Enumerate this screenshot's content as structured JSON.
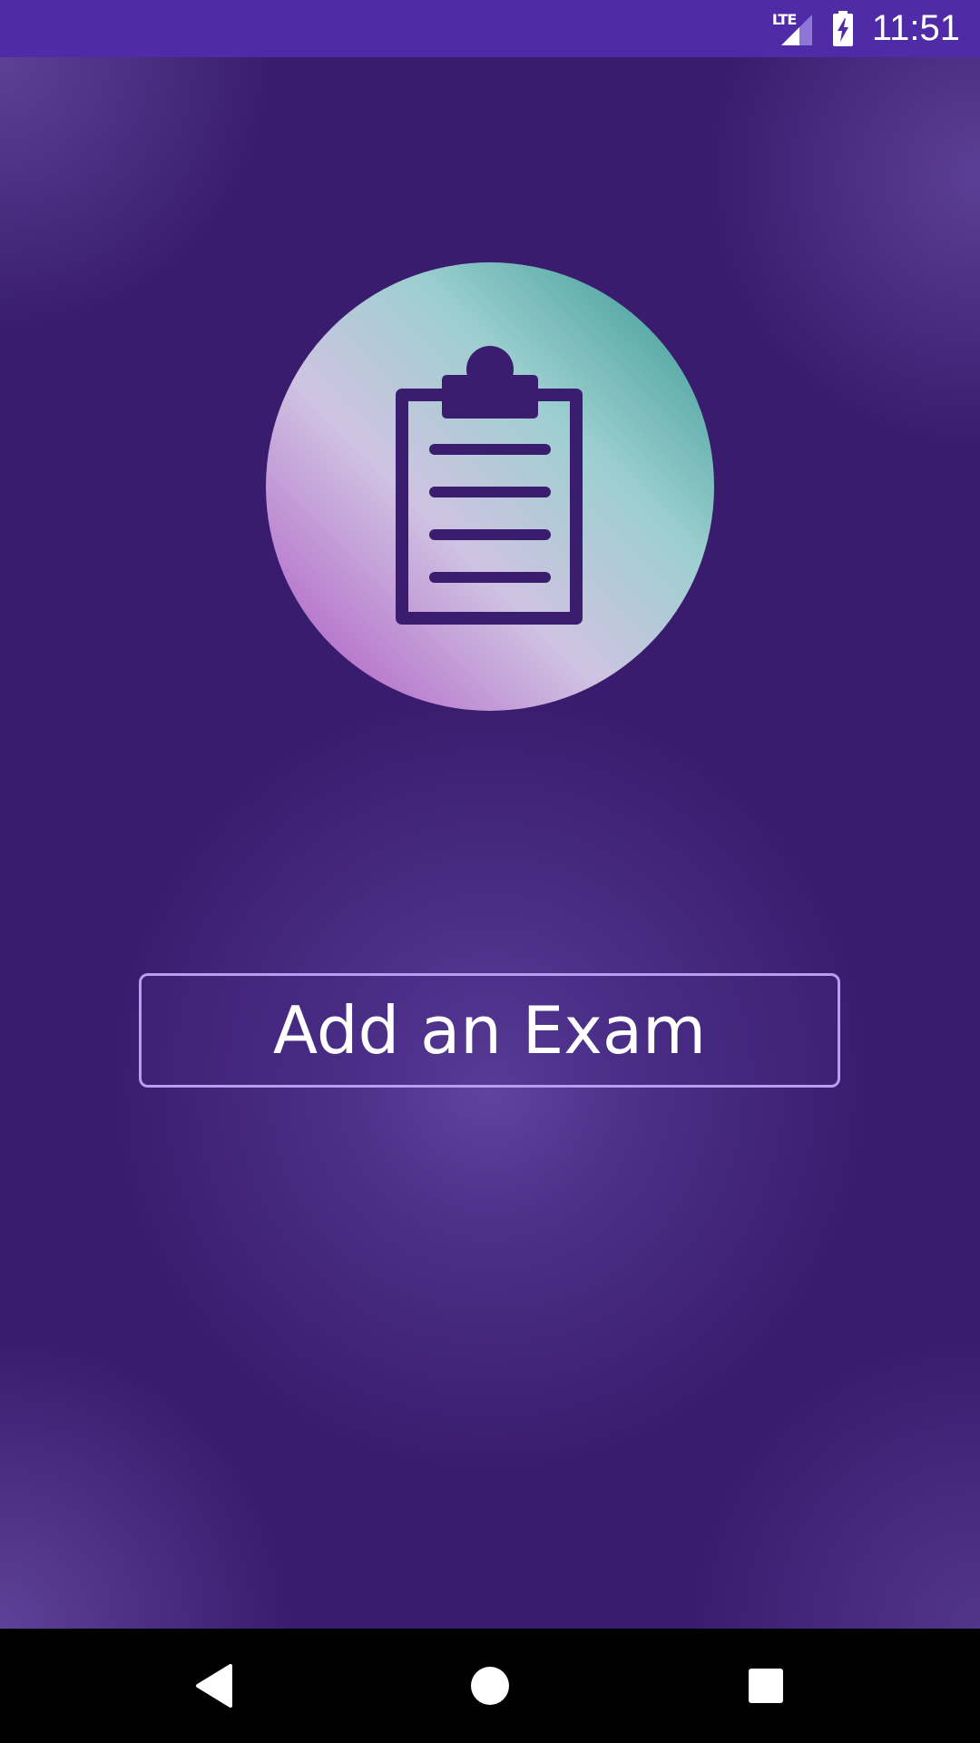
{
  "status_bar": {
    "network_label": "LTE",
    "time": "11:51",
    "icons": [
      "lte-signal-icon",
      "battery-charging-icon"
    ]
  },
  "main": {
    "logo_icon": "clipboard-icon",
    "add_exam_label": "Add an Exam"
  },
  "nav_bar": {
    "icons": [
      "back-icon",
      "home-icon",
      "recents-icon"
    ]
  },
  "colors": {
    "status_bar": "#4f2ba8",
    "background": "#391c6d",
    "button_border": "#b79ef0",
    "icon_purple": "#3a1d6e",
    "logo_teal": "#2f9490",
    "logo_pink": "#b56dca"
  }
}
